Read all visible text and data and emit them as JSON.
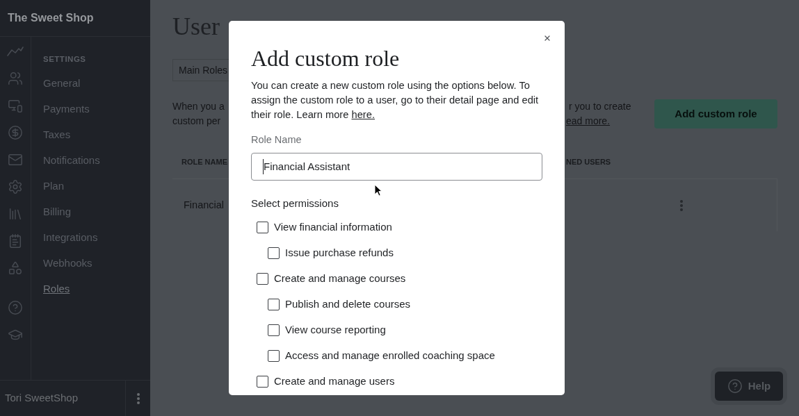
{
  "sidebar": {
    "brand": "The Sweet Shop",
    "section_heading": "SETTINGS",
    "items": [
      {
        "label": "General",
        "selected": false
      },
      {
        "label": "Payments",
        "selected": false
      },
      {
        "label": "Taxes",
        "selected": false
      },
      {
        "label": "Notifications",
        "selected": false
      },
      {
        "label": "Plan",
        "selected": false
      },
      {
        "label": "Billing",
        "selected": false
      },
      {
        "label": "Integrations",
        "selected": false
      },
      {
        "label": "Webhooks",
        "selected": false
      },
      {
        "label": "Roles",
        "selected": true
      }
    ],
    "user_name": "Tori SweetShop"
  },
  "page": {
    "title": "User",
    "tabs": [
      {
        "label": "Main Roles",
        "selected": true
      }
    ],
    "intro_left": [
      "When you a",
      "custom per"
    ],
    "intro_right": [
      {
        "kind": "text",
        "text": "r you to create"
      },
      {
        "kind": "link",
        "text": "ead more."
      }
    ],
    "add_button": "Add custom role",
    "table": {
      "columns": [
        "ROLE NAME",
        "NED USERS"
      ],
      "rows": [
        {
          "cells": [
            "Financial"
          ]
        }
      ]
    }
  },
  "modal": {
    "title": "Add custom role",
    "description": "You can create a new custom role using the options below. To assign the custom role to a user, go to their detail page and edit their role. Learn more",
    "description_link": "here.",
    "field": {
      "label": "Role Name",
      "value": "Financial Assistant"
    },
    "permissions_heading": "Select permissions",
    "permissions": [
      {
        "label": "View financial information",
        "checked": false,
        "children": [
          {
            "label": "Issue purchase refunds",
            "checked": false
          }
        ]
      },
      {
        "label": "Create and manage courses",
        "checked": false,
        "children": [
          {
            "label": "Publish and delete courses",
            "checked": false
          },
          {
            "label": "View course reporting",
            "checked": false
          },
          {
            "label": "Access and manage enrolled coaching space",
            "checked": false
          }
        ]
      },
      {
        "label": "Create and manage users",
        "checked": false
      }
    ]
  },
  "help_button": {
    "label": "Help"
  }
}
